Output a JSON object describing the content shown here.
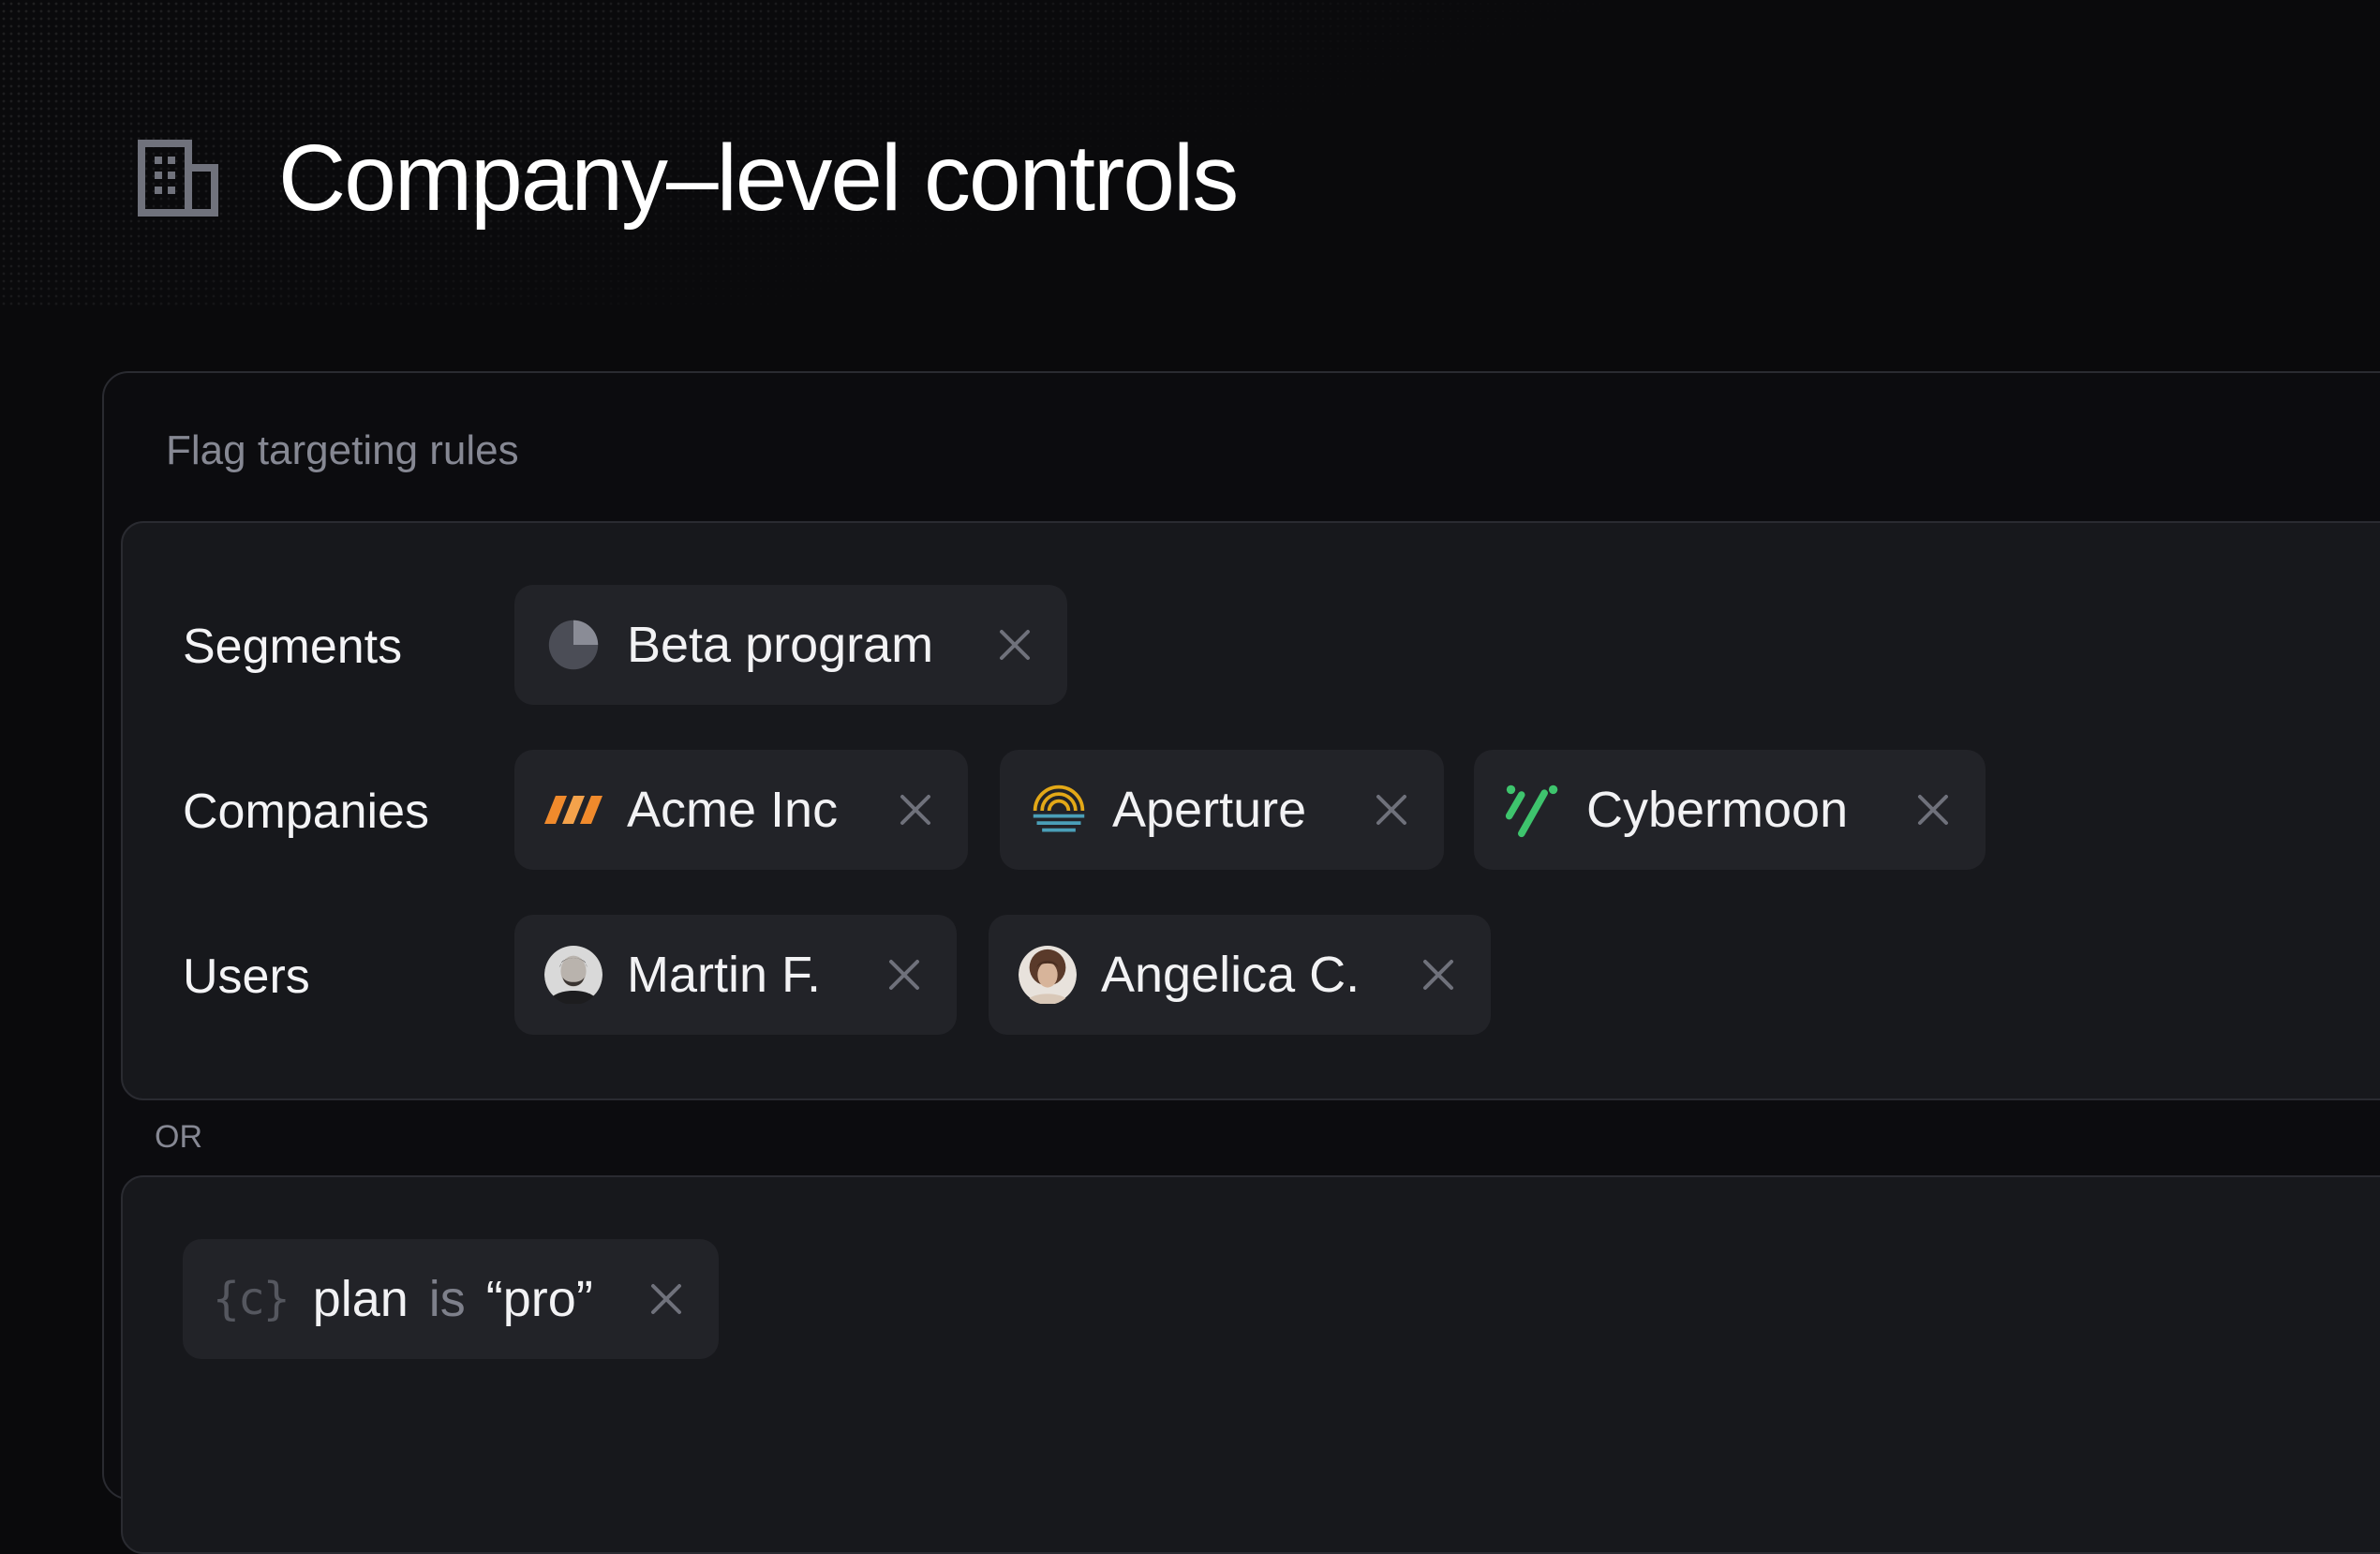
{
  "header": {
    "title": "Company–level controls",
    "icon": "building-icon"
  },
  "panel": {
    "label": "Flag targeting rules",
    "or_label": "OR",
    "rules": {
      "segments_label": "Segments",
      "companies_label": "Companies",
      "users_label": "Users",
      "segments": [
        {
          "label": "Beta program",
          "icon": "pie-chart-icon"
        }
      ],
      "companies": [
        {
          "label": "Acme Inc",
          "icon": "acme-logo-icon",
          "color": "#f08a2c"
        },
        {
          "label": "Aperture",
          "icon": "aperture-logo-icon",
          "color": "#e3a817"
        },
        {
          "label": "Cybermoon",
          "icon": "cybermoon-logo-icon",
          "color": "#3ec46d"
        }
      ],
      "users": [
        {
          "label": "Martin F.",
          "icon": "avatar"
        },
        {
          "label": "Angelica C.",
          "icon": "avatar"
        }
      ]
    },
    "condition": {
      "key": "plan",
      "operator": "is",
      "value": "“pro”",
      "icon": "variable-braces-icon",
      "brace_text": "{c}"
    }
  },
  "colors": {
    "background": "#0a0a0c",
    "card": "#17181c",
    "chip": "#222328",
    "muted": "#868893"
  }
}
